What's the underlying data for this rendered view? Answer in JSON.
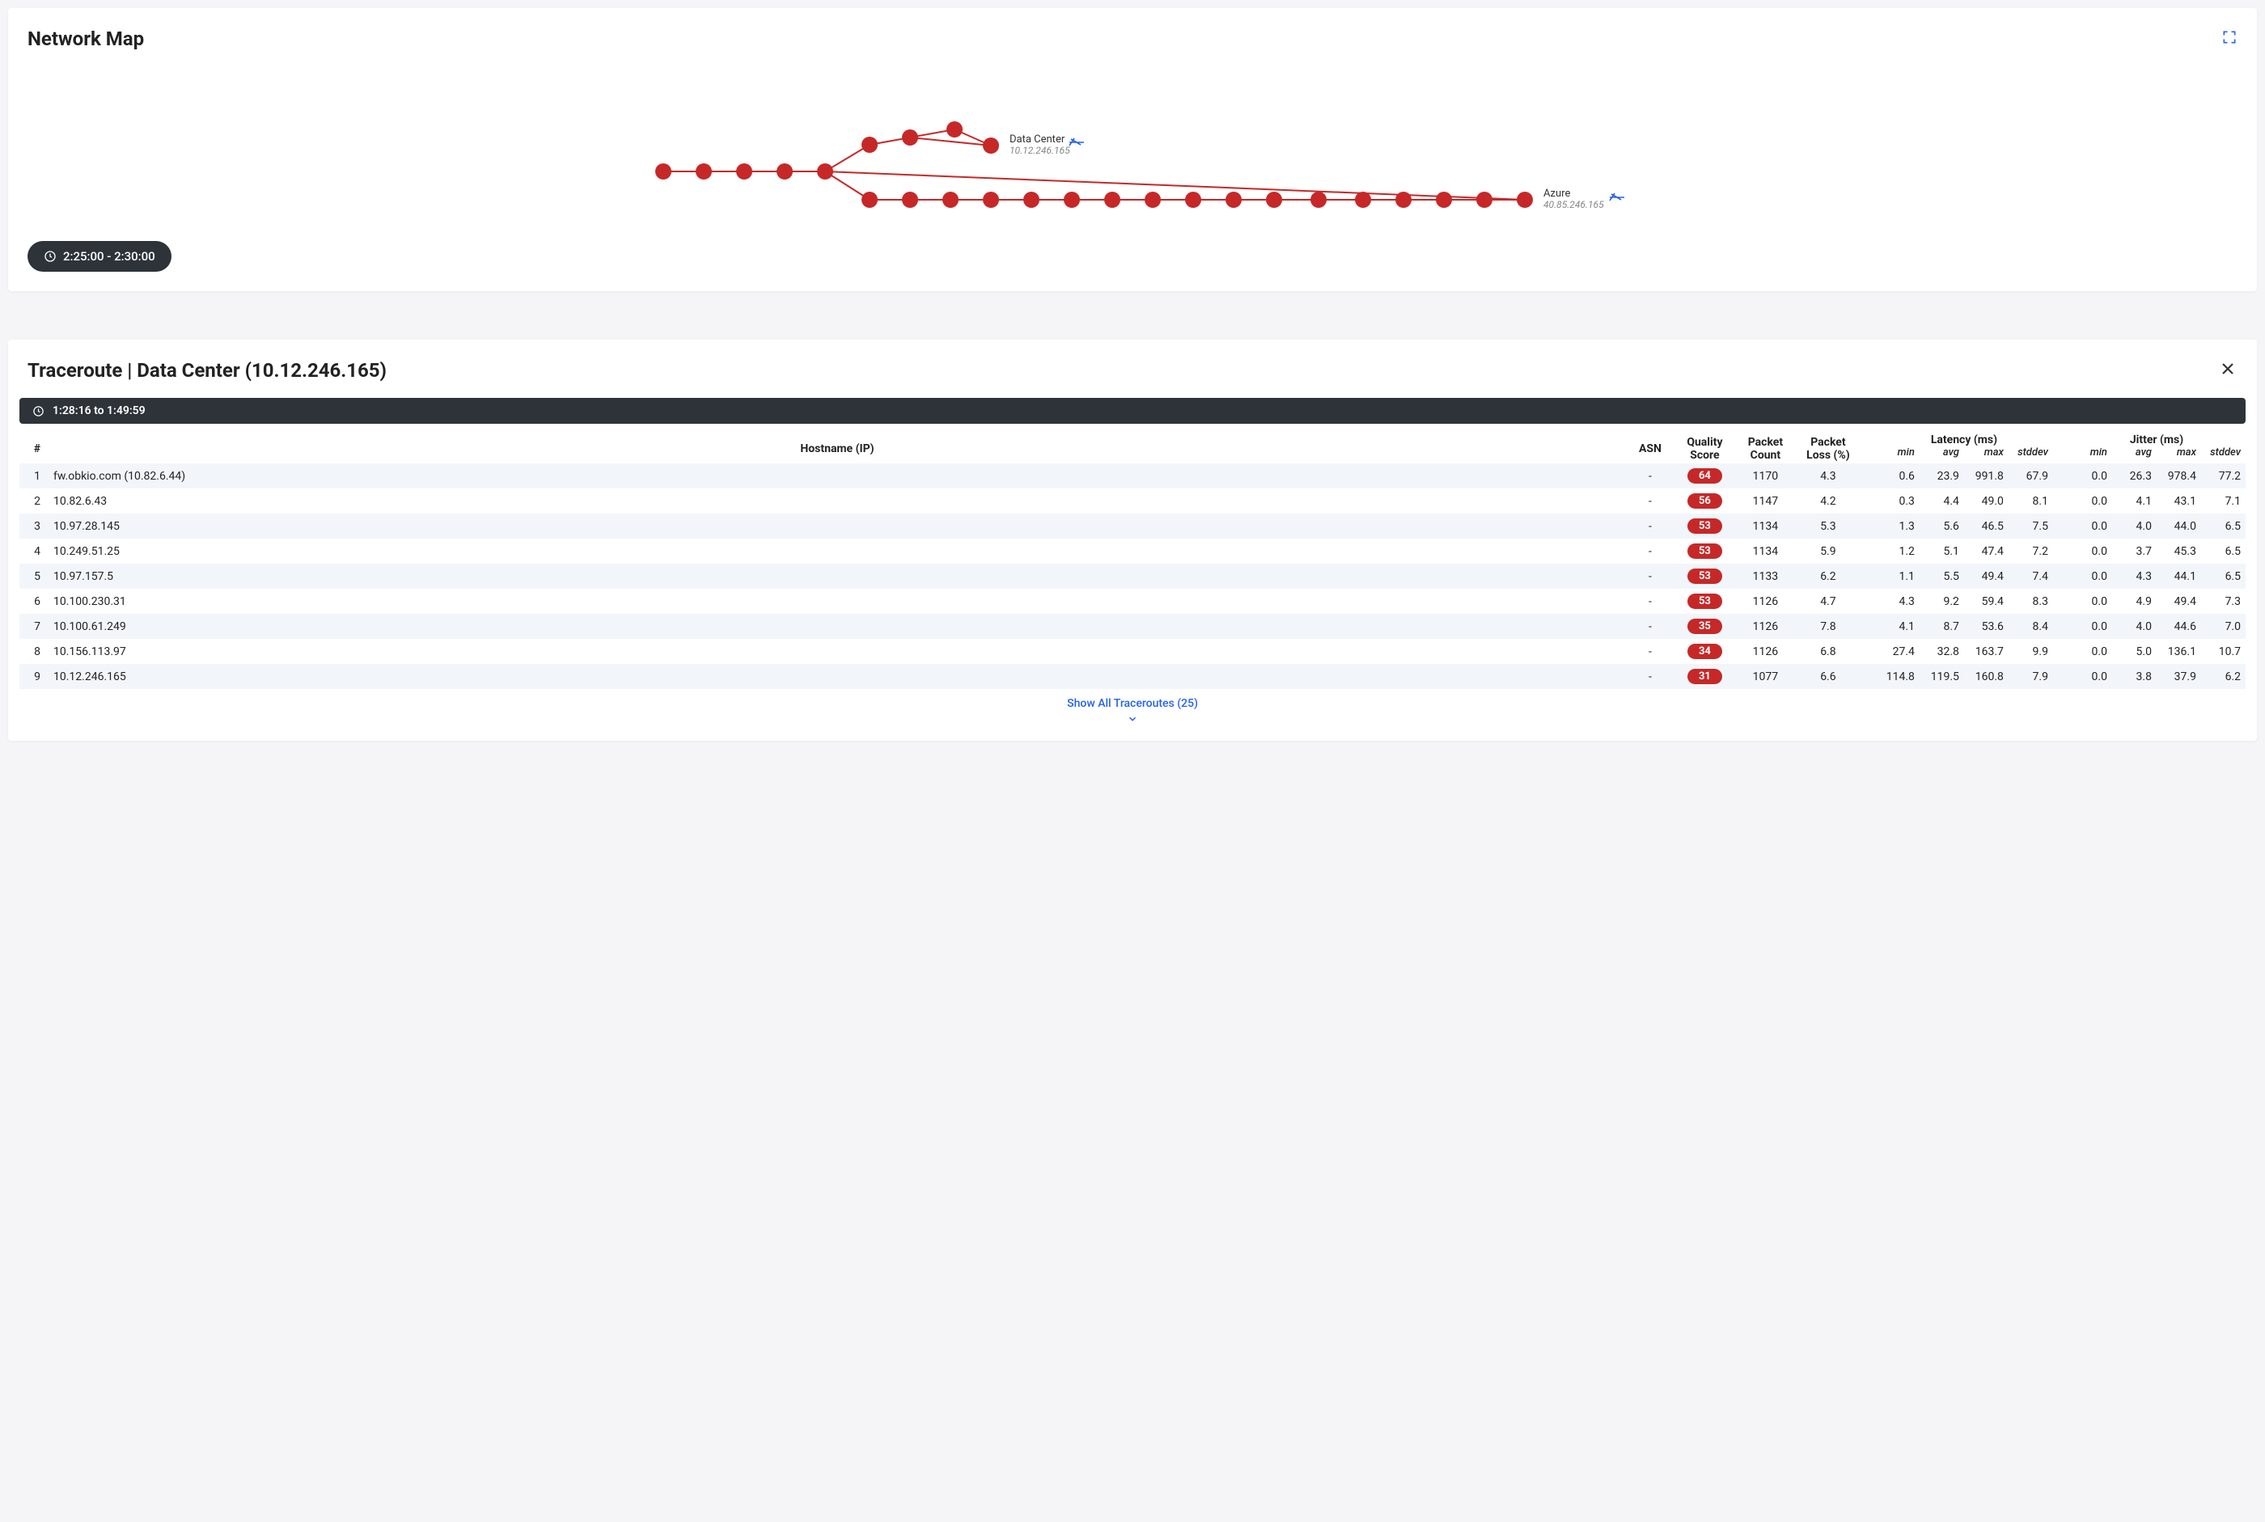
{
  "network_map": {
    "title": "Network Map",
    "time_range": "2:25:00 - 2:30:00",
    "endpoints": {
      "data_center": {
        "label": "Data Center",
        "ip": "10.12.246.165"
      },
      "azure": {
        "label": "Azure",
        "ip": "40.85.246.165"
      }
    }
  },
  "traceroute": {
    "title": "Traceroute | Data Center (10.12.246.165)",
    "time_banner": "1:28:16 to 1:49:59",
    "columns": {
      "idx": "#",
      "hostname": "Hostname (IP)",
      "asn": "ASN",
      "quality": "Quality Score",
      "packet_count": "Packet Count",
      "packet_loss": "Packet Loss (%)",
      "latency": "Latency (ms)",
      "jitter": "Jitter (ms)",
      "min": "min",
      "avg": "avg",
      "max": "max",
      "stddev": "stddev"
    },
    "rows": [
      {
        "idx": "1",
        "host": "fw.obkio.com (10.82.6.44)",
        "asn": "-",
        "quality": "64",
        "pcount": "1170",
        "ploss": "4.3",
        "lmin": "0.6",
        "lavg": "23.9",
        "lmax": "991.8",
        "lstd": "67.9",
        "jmin": "0.0",
        "javg": "26.3",
        "jmax": "978.4",
        "jstd": "77.2"
      },
      {
        "idx": "2",
        "host": "10.82.6.43",
        "asn": "-",
        "quality": "56",
        "pcount": "1147",
        "ploss": "4.2",
        "lmin": "0.3",
        "lavg": "4.4",
        "lmax": "49.0",
        "lstd": "8.1",
        "jmin": "0.0",
        "javg": "4.1",
        "jmax": "43.1",
        "jstd": "7.1"
      },
      {
        "idx": "3",
        "host": "10.97.28.145",
        "asn": "-",
        "quality": "53",
        "pcount": "1134",
        "ploss": "5.3",
        "lmin": "1.3",
        "lavg": "5.6",
        "lmax": "46.5",
        "lstd": "7.5",
        "jmin": "0.0",
        "javg": "4.0",
        "jmax": "44.0",
        "jstd": "6.5"
      },
      {
        "idx": "4",
        "host": "10.249.51.25",
        "asn": "-",
        "quality": "53",
        "pcount": "1134",
        "ploss": "5.9",
        "lmin": "1.2",
        "lavg": "5.1",
        "lmax": "47.4",
        "lstd": "7.2",
        "jmin": "0.0",
        "javg": "3.7",
        "jmax": "45.3",
        "jstd": "6.5"
      },
      {
        "idx": "5",
        "host": "10.97.157.5",
        "asn": "-",
        "quality": "53",
        "pcount": "1133",
        "ploss": "6.2",
        "lmin": "1.1",
        "lavg": "5.5",
        "lmax": "49.4",
        "lstd": "7.4",
        "jmin": "0.0",
        "javg": "4.3",
        "jmax": "44.1",
        "jstd": "6.5"
      },
      {
        "idx": "6",
        "host": "10.100.230.31",
        "asn": "-",
        "quality": "53",
        "pcount": "1126",
        "ploss": "4.7",
        "lmin": "4.3",
        "lavg": "9.2",
        "lmax": "59.4",
        "lstd": "8.3",
        "jmin": "0.0",
        "javg": "4.9",
        "jmax": "49.4",
        "jstd": "7.3"
      },
      {
        "idx": "7",
        "host": "10.100.61.249",
        "asn": "-",
        "quality": "35",
        "pcount": "1126",
        "ploss": "7.8",
        "lmin": "4.1",
        "lavg": "8.7",
        "lmax": "53.6",
        "lstd": "8.4",
        "jmin": "0.0",
        "javg": "4.0",
        "jmax": "44.6",
        "jstd": "7.0"
      },
      {
        "idx": "8",
        "host": "10.156.113.97",
        "asn": "-",
        "quality": "34",
        "pcount": "1126",
        "ploss": "6.8",
        "lmin": "27.4",
        "lavg": "32.8",
        "lmax": "163.7",
        "lstd": "9.9",
        "jmin": "0.0",
        "javg": "5.0",
        "jmax": "136.1",
        "jstd": "10.7"
      },
      {
        "idx": "9",
        "host": "10.12.246.165",
        "asn": "-",
        "quality": "31",
        "pcount": "1077",
        "ploss": "6.6",
        "lmin": "114.8",
        "lavg": "119.5",
        "lmax": "160.8",
        "lstd": "7.9",
        "jmin": "0.0",
        "javg": "3.8",
        "jmax": "37.9",
        "jstd": "6.2"
      }
    ],
    "show_all": "Show All Traceroutes (25)"
  }
}
